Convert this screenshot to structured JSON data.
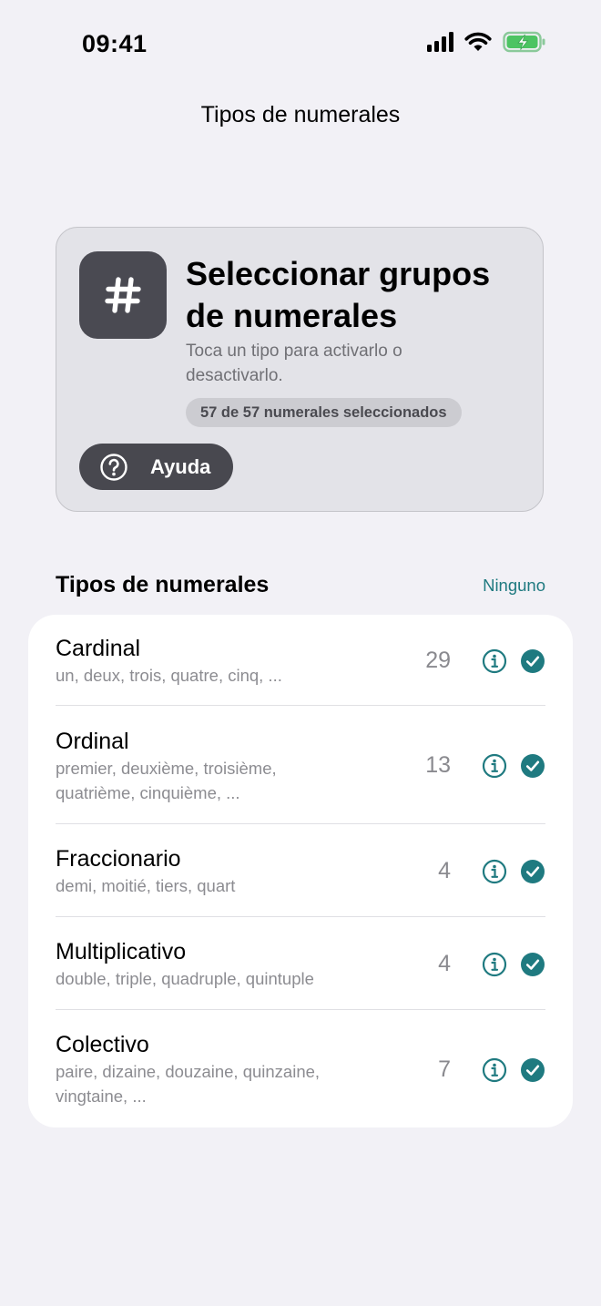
{
  "status_bar": {
    "time": "09:41"
  },
  "nav": {
    "title": "Tipos de numerales"
  },
  "hero": {
    "icon": "hash-icon",
    "title": "Seleccionar grupos de numerales",
    "description": "Toca un tipo para activarlo o desactivarlo.",
    "badge": "57 de 57 numerales seleccionados",
    "help_label": "Ayuda",
    "help_icon": "question-circle-icon"
  },
  "section": {
    "title": "Tipos de numerales",
    "action": "Ninguno"
  },
  "colors": {
    "accent": "#1F7A80",
    "dark": "#48484F",
    "background": "#F2F1F6"
  },
  "items": [
    {
      "title": "Cardinal",
      "examples": "un, deux, trois, quatre, cinq, ...",
      "count": "29",
      "selected": true
    },
    {
      "title": "Ordinal",
      "examples": "premier, deuxième, troisième, quatrième, cinquième, ...",
      "count": "13",
      "selected": true
    },
    {
      "title": "Fraccionario",
      "examples": "demi, moitié, tiers, quart",
      "count": "4",
      "selected": true
    },
    {
      "title": "Multiplicativo",
      "examples": "double, triple, quadruple, quintuple",
      "count": "4",
      "selected": true
    },
    {
      "title": "Colectivo",
      "examples": "paire, dizaine, douzaine, quinzaine, vingtaine, ...",
      "count": "7",
      "selected": true
    }
  ]
}
